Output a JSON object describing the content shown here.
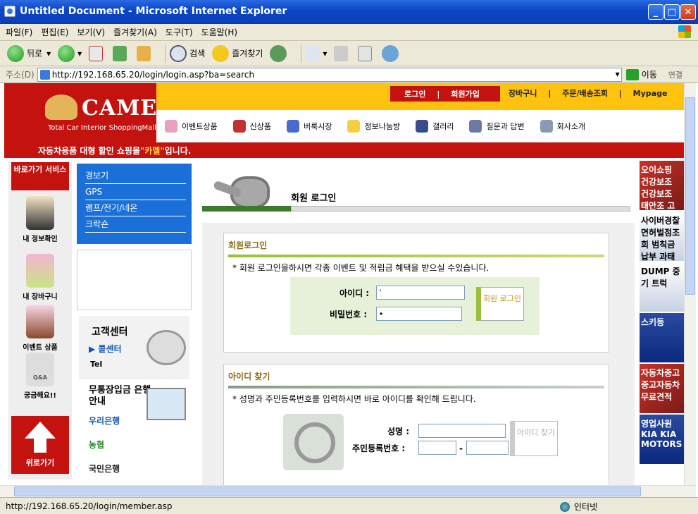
{
  "window": {
    "title": "Untitled Document - Microsoft Internet Explorer"
  },
  "menu": [
    "파일(F)",
    "편집(E)",
    "보기(V)",
    "즐겨찾기(A)",
    "도구(T)",
    "도움말(H)"
  ],
  "toolbar": {
    "back": "뒤로",
    "search": "검색",
    "favorites": "즐겨찾기"
  },
  "address": {
    "label": "주소(D)",
    "url": "http://192.168.65.20/login/login.asp?ba=search",
    "go": "이동",
    "links": "연결"
  },
  "status": {
    "url": "http://192.168.65.20/login/member.asp",
    "zone": "인터넷"
  },
  "site": {
    "logo": "CAMEL",
    "logo_sub": "Total Car Interior ShoppingMall",
    "top": {
      "login": "로그인",
      "join": "회원가입",
      "cart": "장바구니",
      "orders": "주문/배송조회",
      "mypage": "Mypage"
    },
    "nav": [
      "이벤트상품",
      "신상품",
      "버룩시장",
      "정보나눔방",
      "갤러리",
      "질문과 답변",
      "회사소개"
    ],
    "slogan_a": "자동차용품 대형 할인 쇼핑몰 ",
    "slogan_em": "\"카멜\"",
    "slogan_b": " 입니다."
  },
  "quick": {
    "header": "바로가기 서비스",
    "items": [
      "내 정보확인",
      "내 장바구니",
      "이벤트 상품",
      "궁금해요!!"
    ],
    "qa_caption": "Q&A",
    "top": "위로가기"
  },
  "categories": [
    "경보기",
    "GPS",
    "램프/전기/네온",
    "크락숀"
  ],
  "cs": {
    "title": "고객센터",
    "callcenter": "콜센터",
    "tel": "Tel"
  },
  "bank": {
    "title": "무통장입금 은행안내",
    "banks": [
      "우리은행",
      "농협",
      "국민은행"
    ]
  },
  "main": {
    "title": "회원 로그인",
    "login": {
      "title": "회원로그인",
      "desc": "* 회원 로그인을하시면 각종 이벤트 및 적립금 혜택을 받으실 수있습니다.",
      "id_label": "아이디 :",
      "id_value": "'",
      "pw_label": "비밀번호 :",
      "pw_value": "•",
      "button": "회원 로그인"
    },
    "find": {
      "title": "아이디 찾기",
      "desc": "* 성명과 주민등록번호를 입력하시면 바로 아이디를 확인해 드립니다.",
      "name_label": "성명 :",
      "ssn_label": "주민등록번호 :",
      "dash": "-",
      "button": "아이디 찾기"
    }
  },
  "right_ads": [
    "오이쇼핑 건강보조 건강보조 태안조 고뉴",
    "사이버경찰 면허벌점조회 범칙금 납부 과태료 납부 조회서비스",
    "DUMP 중기 트럭",
    "스키동",
    "자동차중고 중고자동차 무료견적",
    "영업사원 KIA KIA MOTORS"
  ]
}
